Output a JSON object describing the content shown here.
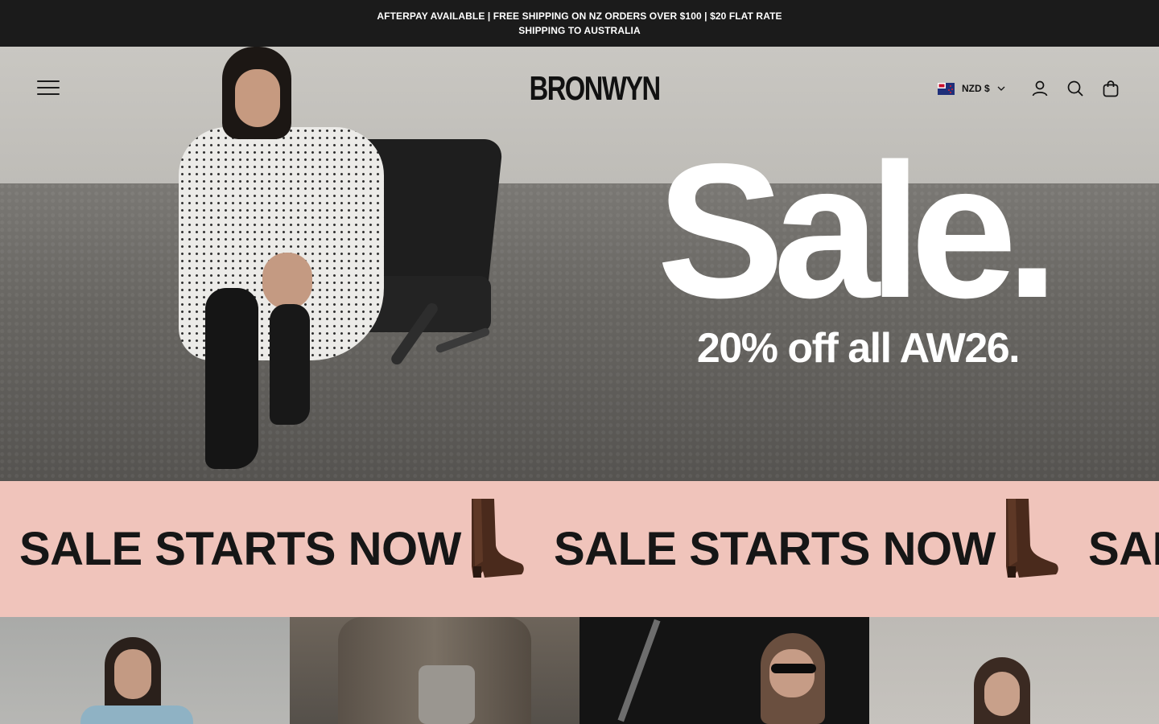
{
  "announcement": {
    "text": "AFTERPAY AVAILABLE | FREE SHIPPING ON NZ ORDERS OVER $100 | $20 FLAT RATE SHIPPING TO AUSTRALIA"
  },
  "header": {
    "logo": "BRONWYN",
    "currency_label": "NZD $",
    "icons": [
      "menu-icon",
      "nz-flag-icon",
      "chevron-down-icon",
      "account-icon",
      "search-icon",
      "cart-icon"
    ]
  },
  "hero": {
    "headline": "Sale.",
    "subheadline": "20% off all AW26."
  },
  "marquee": {
    "text": "SALE STARTS NOW",
    "partial_text": "SAL"
  },
  "colors": {
    "announcement_bg": "#1b1b1b",
    "marquee_bg": "#f0c4bb",
    "text_dark": "#111111",
    "boot_brown": "#4a2a1c"
  }
}
